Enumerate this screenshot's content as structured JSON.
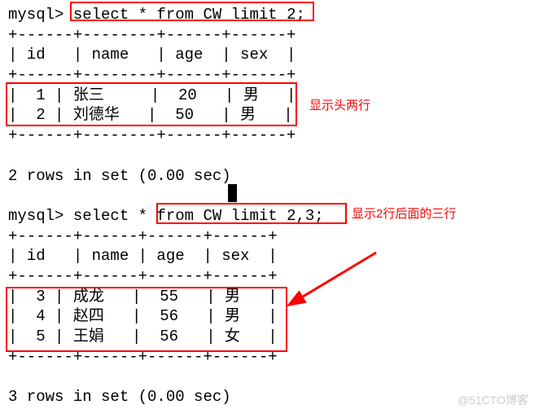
{
  "q1": {
    "prompt": "mysql>",
    "sql": "select * from CW limit 2;",
    "sep": "+------+--------+------+------+",
    "hdr": "| id   | name   | age  | sex  |",
    "rows": [
      "|  1 | 张三     |  20   | 男   |",
      "|  2 | 刘德华   |  50   | 男   |"
    ],
    "footer": "2 rows in set (0.00 sec)"
  },
  "q2": {
    "prompt": "mysql>",
    "sql_pre": "select * ",
    "sql_box": "from CW limit 2,3;",
    "sep": "+------+------+------+------+",
    "hdr": "| id   | name | age  | sex  |",
    "rows": [
      "|  3 | 成龙   |  55   | 男   |",
      "|  4 | 赵四   |  56   | 男   |",
      "|  5 | 王娟   |  56   | 女   |"
    ],
    "footer": "3 rows in set (0.00 sec)"
  },
  "anno1": "显示头两行",
  "anno2": "显示2行后面的三行",
  "wm": "@51CTO博客",
  "chart_data": {
    "type": "table",
    "tables": [
      {
        "query": "select * from CW limit 2;",
        "columns": [
          "id",
          "name",
          "age",
          "sex"
        ],
        "rows": [
          {
            "id": 1,
            "name": "张三",
            "age": 20,
            "sex": "男"
          },
          {
            "id": 2,
            "name": "刘德华",
            "age": 50,
            "sex": "男"
          }
        ],
        "rows_in_set": 2,
        "time_sec": 0.0
      },
      {
        "query": "select * from CW limit 2,3;",
        "columns": [
          "id",
          "name",
          "age",
          "sex"
        ],
        "rows": [
          {
            "id": 3,
            "name": "成龙",
            "age": 55,
            "sex": "男"
          },
          {
            "id": 4,
            "name": "赵四",
            "age": 56,
            "sex": "男"
          },
          {
            "id": 5,
            "name": "王娟",
            "age": 56,
            "sex": "女"
          }
        ],
        "rows_in_set": 3,
        "time_sec": 0.0
      }
    ]
  }
}
